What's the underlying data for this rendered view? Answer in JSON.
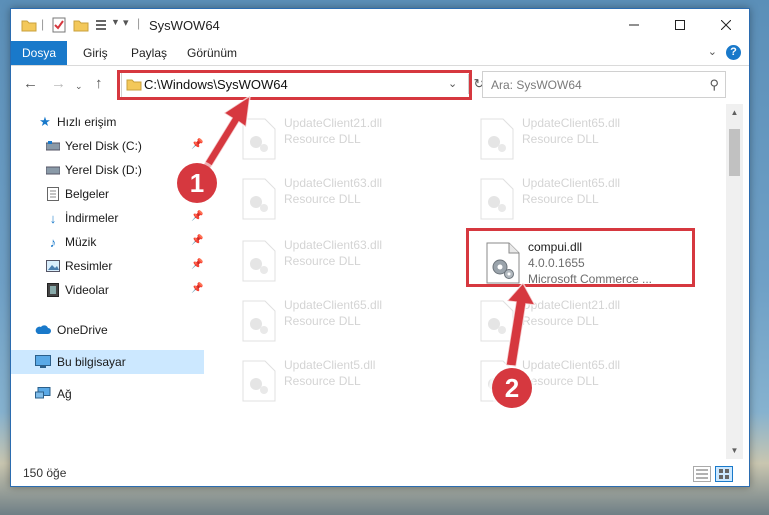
{
  "window": {
    "title": "SysWOW64"
  },
  "ribbon": {
    "tabs": [
      "Dosya",
      "Giriş",
      "Paylaş",
      "Görünüm"
    ],
    "help": "?"
  },
  "nav": {
    "address": "C:\\Windows\\SysWOW64",
    "search_placeholder": "Ara: SysWOW64"
  },
  "sidebar": {
    "items": [
      {
        "label": "Hızlı erişim",
        "icon": "star-icon"
      },
      {
        "label": "Yerel Disk (C:)",
        "icon": "drive-icon",
        "pinned": true
      },
      {
        "label": "Yerel Disk (D:)",
        "icon": "drive-icon"
      },
      {
        "label": "Belgeler",
        "icon": "documents-icon"
      },
      {
        "label": "İndirmeler",
        "icon": "downloads-icon",
        "pinned": true
      },
      {
        "label": "Müzik",
        "icon": "music-icon",
        "pinned": true
      },
      {
        "label": "Resimler",
        "icon": "pictures-icon",
        "pinned": true
      },
      {
        "label": "Videolar",
        "icon": "videos-icon",
        "pinned": true
      },
      {
        "label": "OneDrive",
        "icon": "cloud-icon"
      },
      {
        "label": "Bu bilgisayar",
        "icon": "computer-icon",
        "selected": true
      },
      {
        "label": "Ağ",
        "icon": "network-icon"
      }
    ]
  },
  "files": [
    {
      "name": "UpdateClient21.dll",
      "type": "Resource DLL"
    },
    {
      "name": "UpdateClient65.dll",
      "type": "Resource DLL"
    },
    {
      "name": "UpdateClient63.dll",
      "type": "Resource DLL"
    },
    {
      "name": "UpdateClient65.dll",
      "type": "Resource DLL"
    },
    {
      "name": "UpdateClient63.dll",
      "type": "Resource DLL"
    },
    {
      "name": "compui.dll",
      "version": "4.0.0.1655",
      "type": "Microsoft Commerce ...",
      "highlighted": true
    },
    {
      "name": "UpdateClient65.dll",
      "type": "Resource DLL"
    },
    {
      "name": "UpdateClient21.dll",
      "type": "Resource DLL"
    },
    {
      "name": "UpdateClient5.dll",
      "type": "Resource DLL"
    },
    {
      "name": "UpdateClient65.dll",
      "type": "Resource DLL"
    }
  ],
  "status": {
    "count": "150 öğe"
  },
  "annotations": {
    "step1": "1",
    "step2": "2",
    "color": "#d6383f"
  },
  "colors": {
    "accent": "#1979ca",
    "selected_bg": "#cce8ff"
  }
}
